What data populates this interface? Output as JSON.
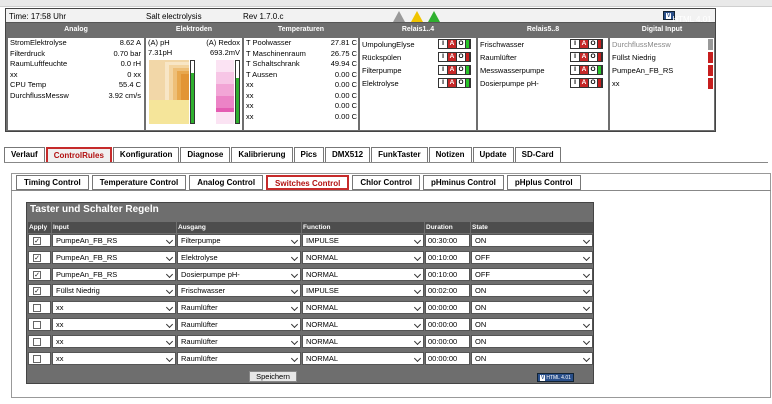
{
  "status": {
    "time": "Time: 17:58 Uhr",
    "mode": "Salt electrolysis",
    "rev": "Rev 1.7.0.c",
    "badge": {
      "mark": "V",
      "text": "HTML 4.01"
    },
    "headers": {
      "analog": "Analog",
      "elektroden": "Elektroden",
      "temperaturen": "Temperaturen",
      "relais1": "Relais1..4",
      "relais5": "Relais5..8",
      "digital": "Digital Input"
    },
    "analog": [
      {
        "k": "StromElektrolyse",
        "v": "8.62 A"
      },
      {
        "k": "Filterdruck",
        "v": "0.70 bar"
      },
      {
        "k": "RaumLuftfeuchte",
        "v": "0.0 rH"
      },
      {
        "k": "xx",
        "v": "0 xx"
      },
      {
        "k": "CPU Temp",
        "v": "55.4 C"
      },
      {
        "k": "DurchflussMessw",
        "v": "3.92 cm/s"
      }
    ],
    "elektroden": {
      "ph_label": "(A) pH",
      "ph_value": "7.31pH",
      "ph_level": 0.8,
      "redox_label": "(A) Redox",
      "redox_value": "693.2mV",
      "redox_level": 0.72
    },
    "temperaturen": [
      {
        "k": "T Poolwasser",
        "v": "27.81 C"
      },
      {
        "k": "T Maschinenraum",
        "v": "26.75 C"
      },
      {
        "k": "T Schaltschrank",
        "v": "49.94 C"
      },
      {
        "k": "T Aussen",
        "v": "0.00 C"
      },
      {
        "k": "xx",
        "v": "0.00 C"
      },
      {
        "k": "xx",
        "v": "0.00 C"
      },
      {
        "k": "xx",
        "v": "0.00 C"
      },
      {
        "k": "xx",
        "v": "0.00 C"
      }
    ],
    "relais1": [
      {
        "label": "UmpolungElyse",
        "led": "on"
      },
      {
        "label": "Rückspülen",
        "led": "off"
      },
      {
        "label": "Filterpumpe",
        "led": "on"
      },
      {
        "label": "Elektrolyse",
        "led": "on"
      }
    ],
    "relais5": [
      {
        "label": "Frischwasser",
        "led": "off"
      },
      {
        "label": "Raumlüfter",
        "led": "off"
      },
      {
        "label": "Messwasserpumpe",
        "led": "on"
      },
      {
        "label": "Dosierpumpe pH-",
        "led": "off"
      }
    ],
    "iao": [
      "I",
      "A",
      "O"
    ],
    "digital": [
      {
        "label": "DurchflussMessw",
        "state": "grey"
      },
      {
        "label": "Füllst Niedrig",
        "state": "red"
      },
      {
        "label": "PumpeAn_FB_RS",
        "state": "red"
      },
      {
        "label": "xx",
        "state": "red"
      }
    ]
  },
  "tabs": [
    "Verlauf",
    "ControlRules",
    "Konfiguration",
    "Diagnose",
    "Kalibrierung",
    "Pics",
    "DMX512",
    "FunkTaster",
    "Notizen",
    "Update",
    "SD-Card"
  ],
  "subtabs": [
    "Timing Control",
    "Temperature Control",
    "Analog Control",
    "Switches Control",
    "Chlor Control",
    "pHminus Control",
    "pHplus Control"
  ],
  "grid": {
    "title": "Taster und Schalter Regeln",
    "headers": [
      "Apply",
      "Input",
      "Ausgang",
      "Function",
      "Duration",
      "State"
    ],
    "rows": [
      {
        "apply": true,
        "input": "PumpeAn_FB_RS",
        "ausgang": "Filterpumpe",
        "function": "IMPULSE",
        "duration": "00:30:00",
        "state": "ON"
      },
      {
        "apply": true,
        "input": "PumpeAn_FB_RS",
        "ausgang": "Elektrolyse",
        "function": "NORMAL",
        "duration": "00:10:00",
        "state": "OFF"
      },
      {
        "apply": true,
        "input": "PumpeAn_FB_RS",
        "ausgang": "Dosierpumpe pH-",
        "function": "NORMAL",
        "duration": "00:10:00",
        "state": "OFF"
      },
      {
        "apply": true,
        "input": "Füllst Niedrig",
        "ausgang": "Frischwasser",
        "function": "IMPULSE",
        "duration": "00:02:00",
        "state": "ON"
      },
      {
        "apply": false,
        "input": "xx",
        "ausgang": "Raumlüfter",
        "function": "NORMAL",
        "duration": "00:00:00",
        "state": "ON"
      },
      {
        "apply": false,
        "input": "xx",
        "ausgang": "Raumlüfter",
        "function": "NORMAL",
        "duration": "00:00:00",
        "state": "ON"
      },
      {
        "apply": false,
        "input": "xx",
        "ausgang": "Raumlüfter",
        "function": "NORMAL",
        "duration": "00:00:00",
        "state": "ON"
      },
      {
        "apply": false,
        "input": "xx",
        "ausgang": "Raumlüfter",
        "function": "NORMAL",
        "duration": "00:00:00",
        "state": "ON"
      }
    ],
    "save_label": "Speichern"
  }
}
